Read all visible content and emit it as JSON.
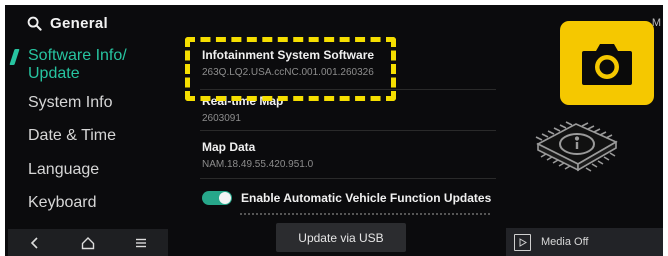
{
  "header": {
    "title": "General",
    "status_letter": "M"
  },
  "menu": {
    "items": [
      {
        "label": "Software Info/"
      },
      {
        "label": "Update"
      },
      {
        "label": "System Info"
      },
      {
        "label": "Date & Time"
      },
      {
        "label": "Language"
      },
      {
        "label": "Keyboard"
      }
    ],
    "active_index": 0
  },
  "software": {
    "infotainment_title": "Infotainment System Software",
    "infotainment_value": "263Q.LQ2.USA.ccNC.001.001.260326",
    "map_title": "Real-time Map",
    "map_value": "2603091",
    "mapdata_title": "Map Data",
    "mapdata_value": "NAM.18.49.55.420.951.0",
    "toggle_label": "Enable Automatic Vehicle Function Updates",
    "toggle_on": true
  },
  "actions": {
    "update_usb_label": "Update via USB"
  },
  "media": {
    "label": "Media Off"
  },
  "icons": {
    "search": "search-icon",
    "back": "back-icon",
    "home": "home-icon",
    "menu": "menu-icon",
    "camera": "camera-icon",
    "chip": "chip-info-icon",
    "media": "media-play-icon"
  },
  "colors": {
    "accent": "#27c4a0",
    "highlight": "#f5de00",
    "camera_bg": "#f5c800",
    "background": "#0b0b0d"
  }
}
